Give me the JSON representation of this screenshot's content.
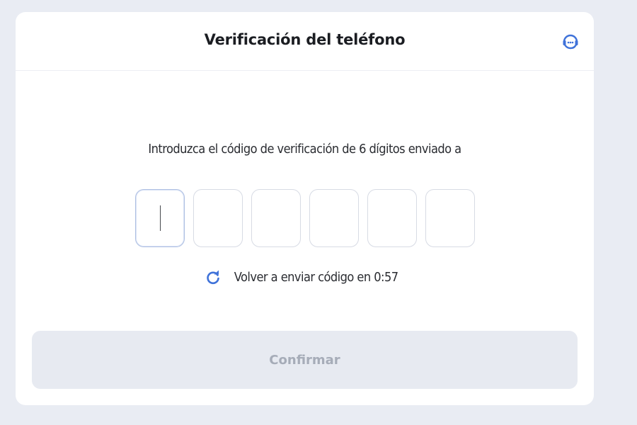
{
  "header": {
    "title": "Verificación del teléfono",
    "support_icon": "headset-icon"
  },
  "main": {
    "instruction": "Introduzca el código de verificación de 6 dígitos enviado a",
    "otp": {
      "length": 6,
      "values": [
        "",
        "",
        "",
        "",
        "",
        ""
      ],
      "focused_index": 0
    },
    "resend": {
      "icon": "refresh-icon",
      "label": "Volver a enviar código en 0:57"
    },
    "confirm_label": "Confirmar"
  },
  "colors": {
    "page_background": "#e9ecf3",
    "card_background": "#ffffff",
    "accent": "#3f72d9",
    "button_disabled_bg": "#e7eaf1",
    "button_disabled_text": "#a6acb8"
  }
}
